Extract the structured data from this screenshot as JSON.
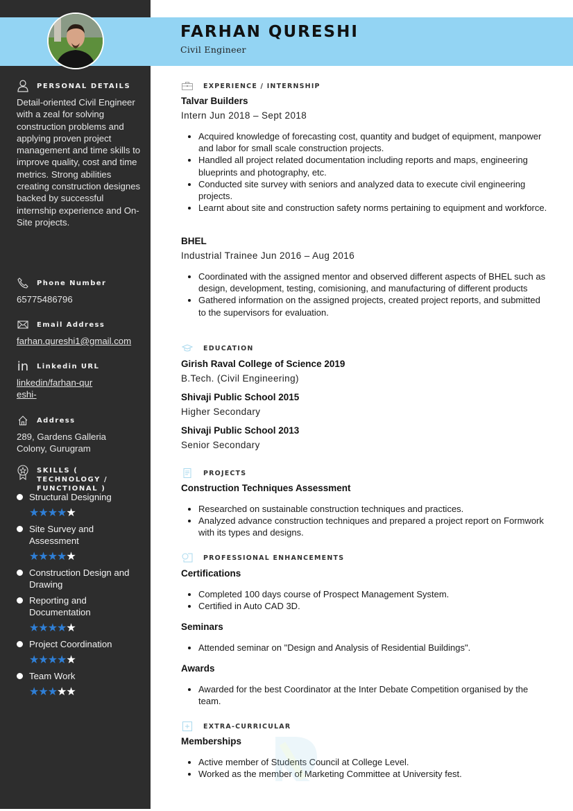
{
  "header": {
    "name": "FARHAN QURESHI",
    "title": "Civil Engineer",
    "band_color": "#93d4f3"
  },
  "sidebar": {
    "background": "#2d2d2d",
    "personal": {
      "icon": "person-icon",
      "label": "PERSONAL DETAILS",
      "summary": "Detail-oriented Civil Engineer with a zeal for solving construction problems and applying proven project management and time skills to improve quality, cost and time metrics. Strong abilities creating construction designes backed by successful internship experience and On-Site projects."
    },
    "phone": {
      "icon": "phone-icon",
      "label": "Phone Number",
      "value": "65775486796"
    },
    "email": {
      "icon": "envelope-icon",
      "label": "Email Address",
      "value": "farhan.qureshi1@gmail.com"
    },
    "linkedin": {
      "icon": "linkedin-icon",
      "label": "Linkedin URL",
      "value": "linkedin/farhan-qureshi-"
    },
    "address": {
      "icon": "home-icon",
      "label": "Address",
      "value": "289, Gardens Galleria Colony, Gurugram"
    },
    "skills": {
      "icon": "award-icon",
      "label": "SKILLS ( TECHNOLOGY / FUNCTIONAL )",
      "star_color": "#2f7fd6",
      "items": [
        {
          "name": "Structural Designing",
          "rating": 4,
          "max": 5
        },
        {
          "name": "Site Survey and Assessment",
          "rating": 4,
          "max": 5
        },
        {
          "name": "Construction Design and Drawing",
          "rating": null,
          "max": null
        },
        {
          "name": "Reporting and Documentation",
          "rating": 4,
          "max": 5
        },
        {
          "name": "Project Coordination",
          "rating": 4,
          "max": 5
        },
        {
          "name": "Team Work",
          "rating": 3,
          "max": 5
        }
      ]
    }
  },
  "main": {
    "experience": {
      "label": "EXPERIENCE / INTERNSHIP",
      "icon": "briefcase-icon",
      "jobs": [
        {
          "company": "Talvar Builders",
          "role_dates": "Intern Jun 2018 – Sept 2018",
          "bullets": [
            "Acquired knowledge of forecasting cost, quantity and budget of equipment, manpower and labor for small scale construction projects.",
            "Handled all project related documentation including reports and maps, engineering blueprints and photography, etc.",
            "Conducted site survey with seniors and analyzed data to execute civil engineering projects.",
            "Learnt about site and construction safety norms pertaining to equipment and workforce."
          ]
        },
        {
          "company": "BHEL",
          "role_dates": "Industrial Trainee Jun 2016 – Aug 2016",
          "bullets": [
            "Coordinated with the assigned mentor and observed different aspects of BHEL such as design, development, testing, comisioning, and manufacturing of different products",
            "Gathered information on the assigned projects, created project reports, and submitted to the supervisors for evaluation."
          ]
        }
      ]
    },
    "education": {
      "label": "EDUCATION",
      "icon": "graduation-cap-icon",
      "items": [
        {
          "school": "Girish Raval College of Science 2019",
          "degree": "B.Tech. (Civil Engineering)"
        },
        {
          "school": "Shivaji Public School 2015",
          "degree": "Higher Secondary"
        },
        {
          "school": "Shivaji Public School 2013",
          "degree": "Senior Secondary"
        }
      ]
    },
    "projects": {
      "label": "PROJECTS",
      "icon": "document-icon",
      "title": "Construction Techniques Assessment",
      "bullets": [
        "Researched on sustainable construction techniques and practices.",
        "Analyzed advance construction techniques and prepared a project report on Formwork with its types and designs."
      ]
    },
    "enhancements": {
      "label": "PROFESSIONAL ENHANCEMENTS",
      "icon": "certificate-icon",
      "groups": [
        {
          "title": "Certifications",
          "bullets": [
            "Completed 100 days course of Prospect Management System.",
            "Certified in Auto CAD 3D."
          ]
        },
        {
          "title": "Seminars",
          "bullets": [
            "Attended seminar on \"Design and Analysis of Residential Buildings\"."
          ]
        },
        {
          "title": "Awards",
          "bullets": [
            "Awarded for the best Coordinator at the Inter Debate Competition organised by the team."
          ]
        }
      ]
    },
    "extra": {
      "label": "EXTRA-CURRICULAR",
      "icon": "plus-box-icon",
      "title": "Memberships",
      "bullets": [
        "Active member of Students Council at College Level.",
        "Worked as the member of Marketing Committee at University fest."
      ]
    }
  }
}
